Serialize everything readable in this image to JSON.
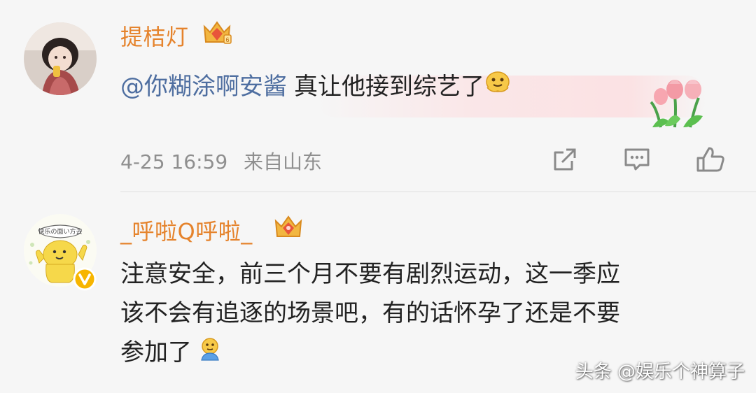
{
  "comments": [
    {
      "username": "提桔灯",
      "mention": "@你糊涂啊安酱",
      "text": "真让他接到综艺了",
      "time": "4-25 16:59",
      "location": "来自山东",
      "badge_icon": "crown-badge-icon",
      "emoji_icon": "melting-face-emoji-icon",
      "decoration_icon": "tulip-decoration-icon"
    },
    {
      "username": "_呼啦Q呼啦_",
      "text_lines": [
        "注意安全，前三个月不要有剧烈运动，这一季应",
        "该不会有追逐的场景吧，有的话怀孕了还是不要",
        "参加了"
      ],
      "badge_icon": "crown-badge-icon",
      "verified_icon": "verified-v-icon",
      "avatar_sign": "快乐の面い方去",
      "emoji_icon": "face-emoji-icon"
    }
  ],
  "actions": {
    "share_icon": "share-icon",
    "comment_icon": "comment-icon",
    "like_icon": "like-icon"
  },
  "watermark": "头条 @娱乐个神算子",
  "colors": {
    "username": "#e5832c",
    "mention": "#4e6ea0",
    "meta": "#8f8f8f",
    "background": "#f6f6f6"
  }
}
